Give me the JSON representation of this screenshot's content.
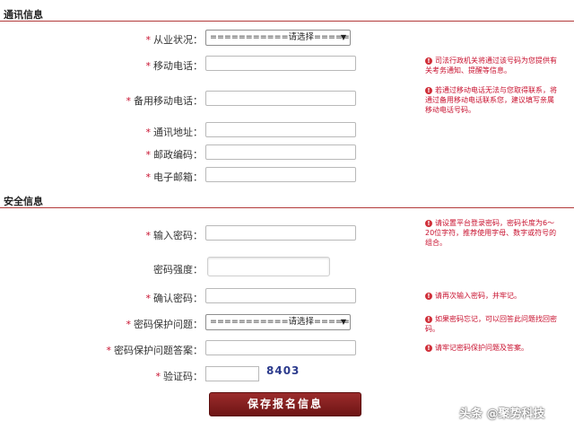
{
  "sections": {
    "contact_title": "通讯信息",
    "security_title": "安全信息"
  },
  "fields": {
    "employment_status": {
      "label": "从业状况：",
      "select_value": "===========请选择==========="
    },
    "mobile": {
      "label": "移动电话：",
      "hint": "司法行政机关将通过该号码为您提供有关考务通知、提醒等信息。"
    },
    "backup_mobile": {
      "label": "备用移动电话：",
      "hint": "若通过移动电话无法与您取得联系，将通过备用移动电话联系您，建议填写亲属移动电话号码。"
    },
    "address": {
      "label": "通讯地址："
    },
    "postcode": {
      "label": "邮政编码："
    },
    "email": {
      "label": "电子邮箱："
    },
    "password": {
      "label": "输入密码：",
      "hint": "请设置平台登录密码，密码长度为6～20位字符，推荐使用字母、数字或符号的组合。"
    },
    "strength": {
      "label": "密码强度："
    },
    "confirm_password": {
      "label": "确认密码：",
      "hint": "请再次输入密码，并牢记。"
    },
    "security_question": {
      "label": "密码保护问题：",
      "select_value": "===========请选择===========",
      "hint": "如果密码忘记，可以回答此问题找回密码。"
    },
    "security_answer": {
      "label": "密码保护问题答案：",
      "hint": "请牢记密码保护问题及答案。"
    },
    "captcha": {
      "label": "验证码：",
      "code": "8403"
    }
  },
  "required_mark": "*",
  "submit_label": "保存报名信息",
  "watermark": "头条 @聚势科技",
  "icons": {
    "hint": "info-icon",
    "dropdown": "chevron-down-icon"
  },
  "colors": {
    "accent": "#8b1f1f",
    "hint_text": "#c8102e",
    "captcha": "#2b3a8c"
  }
}
